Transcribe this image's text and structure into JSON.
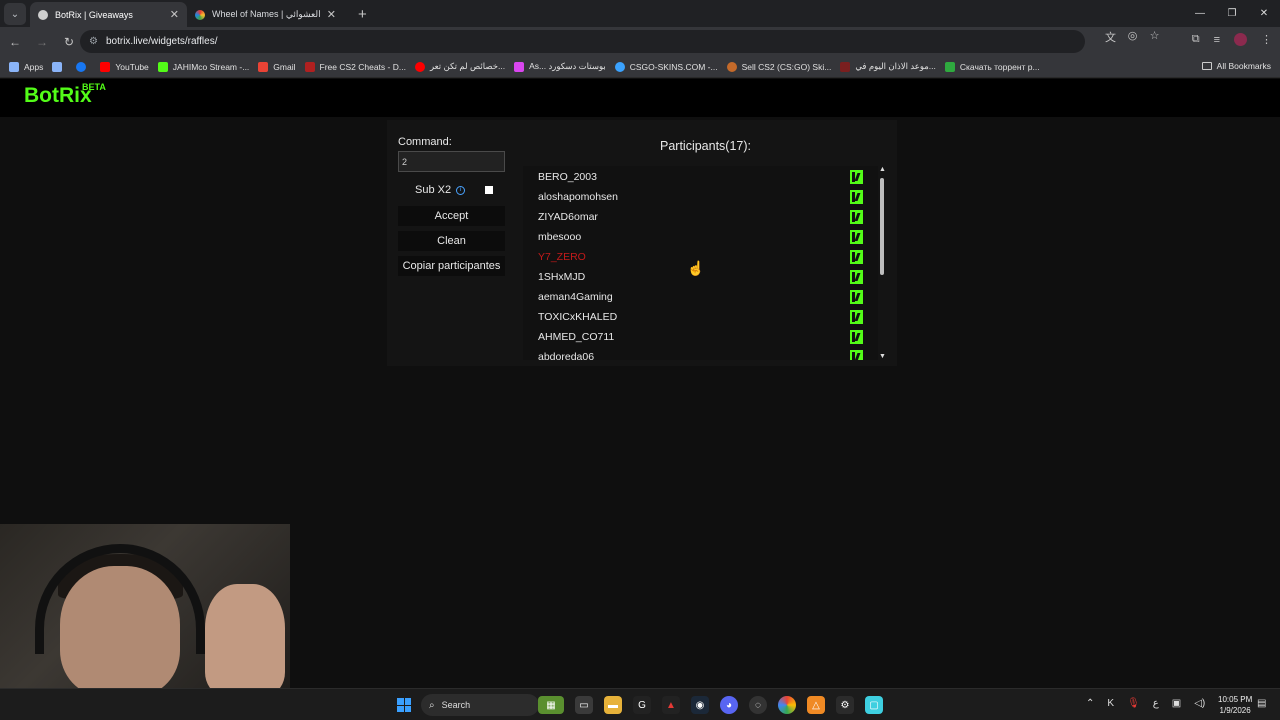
{
  "browser": {
    "tabs": [
      {
        "title": "BotRix | Giveaways",
        "active": true
      },
      {
        "title": "Wheel of Names | اسم العشوائي",
        "active": false
      }
    ],
    "url": "botrix.live/widgets/raffles/",
    "bookmarks": [
      {
        "label": "Apps",
        "color": "#8ab4f8"
      },
      {
        "label": "",
        "color": "#8ab4f8"
      },
      {
        "label": "YouTube",
        "color": "#ff0000"
      },
      {
        "label": "JAHIMco Stream -...",
        "color": "#53fc18"
      },
      {
        "label": "Gmail",
        "color": "#ea4335"
      },
      {
        "label": "Free CS2 Cheats - D...",
        "color": "#b02020"
      },
      {
        "label": "خصائص لم تكن تعر...",
        "color": "#ff0000"
      },
      {
        "label": "As... بوستات دسكورد",
        "color": "#d946ef"
      },
      {
        "label": "CSGO-SKINS.COM -...",
        "color": "#3ba3ff"
      },
      {
        "label": "Sell CS2 (CS:GO) Ski...",
        "color": "#c46a2a"
      },
      {
        "label": "موعد الاذان اليوم في...",
        "color": "#7a1f1f"
      },
      {
        "label": "Скачать торрент р...",
        "color": "#2faa3f"
      }
    ],
    "all_bookmarks": "All Bookmarks"
  },
  "site": {
    "logo": "BotRix",
    "beta": "BETA"
  },
  "raffle": {
    "command_label": "Command:",
    "command_value": "2",
    "sub_label": "Sub X2",
    "sub_checked": false,
    "accept_label": "Accept",
    "clean_label": "Clean",
    "copy_label": "Copiar participantes",
    "participants_title": "Participants(17):",
    "participants": [
      {
        "name": "BERO_2003",
        "highlight": false
      },
      {
        "name": "aloshapomohsen",
        "highlight": false
      },
      {
        "name": "ZIYAD6omar",
        "highlight": false
      },
      {
        "name": "mbesooo",
        "highlight": false
      },
      {
        "name": "Y7_ZERO",
        "highlight": true
      },
      {
        "name": "1SHxMJD",
        "highlight": false
      },
      {
        "name": "aeman4Gaming",
        "highlight": false
      },
      {
        "name": "TOXICxKHALED",
        "highlight": false
      },
      {
        "name": "AHMED_CO711",
        "highlight": false
      },
      {
        "name": "abdoreda06",
        "highlight": false
      }
    ]
  },
  "taskbar": {
    "search_placeholder": "Search",
    "time": "10:05 PM",
    "date": "1/9/2026",
    "lang": "ع"
  }
}
